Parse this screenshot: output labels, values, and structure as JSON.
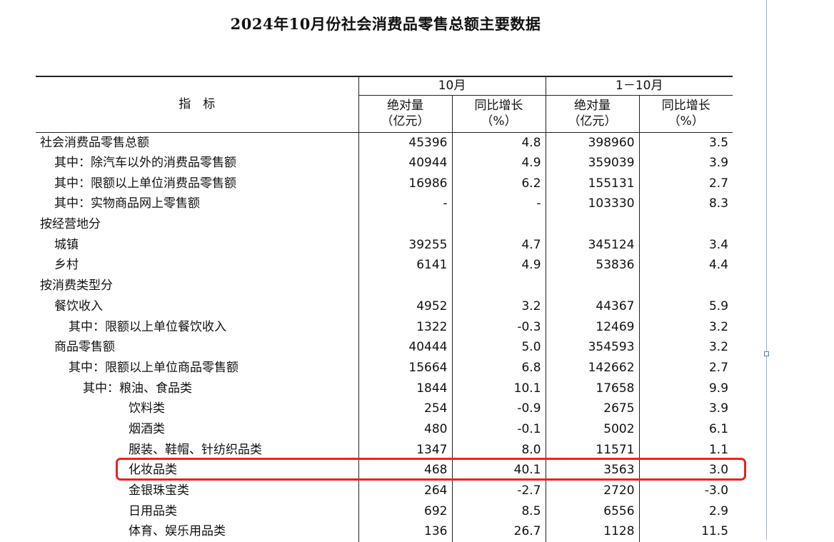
{
  "title": "2024年10月份社会消费品零售总额主要数据",
  "header": {
    "indicator": "指　标",
    "groups": [
      "10月",
      "1－10月"
    ],
    "abs_label": "绝对量",
    "abs_unit": "（亿元）",
    "yoy_label": "同比增长",
    "yoy_unit": "（%）"
  },
  "rows": [
    {
      "name": "社会消费品零售总额",
      "oct_abs": "45396",
      "oct_yoy": "4.8",
      "ytd_abs": "398960",
      "ytd_yoy": "3.5"
    },
    {
      "name": "其中：除汽车以外的消费品零售额",
      "oct_abs": "40944",
      "oct_yoy": "4.9",
      "ytd_abs": "359039",
      "ytd_yoy": "3.9"
    },
    {
      "name": "其中：限额以上单位消费品零售额",
      "oct_abs": "16986",
      "oct_yoy": "6.2",
      "ytd_abs": "155131",
      "ytd_yoy": "2.7"
    },
    {
      "name": "其中：实物商品网上零售额",
      "oct_abs": "-",
      "oct_yoy": "-",
      "ytd_abs": "103330",
      "ytd_yoy": "8.3"
    },
    {
      "name": "按经营地分",
      "oct_abs": "",
      "oct_yoy": "",
      "ytd_abs": "",
      "ytd_yoy": ""
    },
    {
      "name": "城镇",
      "oct_abs": "39255",
      "oct_yoy": "4.7",
      "ytd_abs": "345124",
      "ytd_yoy": "3.4"
    },
    {
      "name": "乡村",
      "oct_abs": "6141",
      "oct_yoy": "4.9",
      "ytd_abs": "53836",
      "ytd_yoy": "4.4"
    },
    {
      "name": "按消费类型分",
      "oct_abs": "",
      "oct_yoy": "",
      "ytd_abs": "",
      "ytd_yoy": ""
    },
    {
      "name": "餐饮收入",
      "oct_abs": "4952",
      "oct_yoy": "3.2",
      "ytd_abs": "44367",
      "ytd_yoy": "5.9"
    },
    {
      "name": "其中：限额以上单位餐饮收入",
      "oct_abs": "1322",
      "oct_yoy": "-0.3",
      "ytd_abs": "12469",
      "ytd_yoy": "3.2"
    },
    {
      "name": "商品零售额",
      "oct_abs": "40444",
      "oct_yoy": "5.0",
      "ytd_abs": "354593",
      "ytd_yoy": "3.2"
    },
    {
      "name": "其中：限额以上单位商品零售额",
      "oct_abs": "15664",
      "oct_yoy": "6.8",
      "ytd_abs": "142662",
      "ytd_yoy": "2.7"
    },
    {
      "name": "其中：粮油、食品类",
      "oct_abs": "1844",
      "oct_yoy": "10.1",
      "ytd_abs": "17658",
      "ytd_yoy": "9.9"
    },
    {
      "name": "饮料类",
      "oct_abs": "254",
      "oct_yoy": "-0.9",
      "ytd_abs": "2675",
      "ytd_yoy": "3.9"
    },
    {
      "name": "烟酒类",
      "oct_abs": "480",
      "oct_yoy": "-0.1",
      "ytd_abs": "5002",
      "ytd_yoy": "6.1"
    },
    {
      "name": "服装、鞋帽、针纺织品类",
      "oct_abs": "1347",
      "oct_yoy": "8.0",
      "ytd_abs": "11571",
      "ytd_yoy": "1.1"
    },
    {
      "name": "化妆品类",
      "oct_abs": "468",
      "oct_yoy": "40.1",
      "ytd_abs": "3563",
      "ytd_yoy": "3.0"
    },
    {
      "name": "金银珠宝类",
      "oct_abs": "264",
      "oct_yoy": "-2.7",
      "ytd_abs": "2720",
      "ytd_yoy": "-3.0"
    },
    {
      "name": "日用品类",
      "oct_abs": "692",
      "oct_yoy": "8.5",
      "ytd_abs": "6556",
      "ytd_yoy": "2.9"
    },
    {
      "name": "体育、娱乐用品类",
      "oct_abs": "136",
      "oct_yoy": "26.7",
      "ytd_abs": "1128",
      "ytd_yoy": "11.5"
    }
  ],
  "highlight": {
    "color": "#e8231c"
  }
}
